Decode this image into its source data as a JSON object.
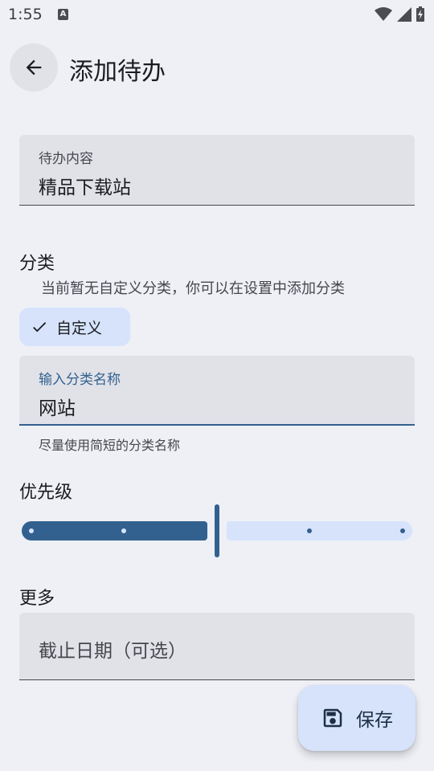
{
  "status": {
    "time": "1:55",
    "notification_icon": "A"
  },
  "appbar": {
    "title": "添加待办"
  },
  "todo_field": {
    "label": "待办内容",
    "value": "精品下载站"
  },
  "category": {
    "title": "分类",
    "hint": "当前暂无自定义分类，你可以在设置中添加分类",
    "chip_label": "自定义",
    "name_field": {
      "label": "输入分类名称",
      "value": "网站",
      "helper": "尽量使用简短的分类名称"
    }
  },
  "priority": {
    "title": "优先级",
    "level_fraction": 0.5,
    "steps": 5
  },
  "more": {
    "title": "更多",
    "deadline_placeholder": "截止日期（可选）"
  },
  "fab": {
    "label": "保存"
  },
  "colors": {
    "primary": "#33618f",
    "primary_container": "#d6e3fb",
    "surface_variant": "#e1e2e8",
    "background": "#eef0f6"
  }
}
